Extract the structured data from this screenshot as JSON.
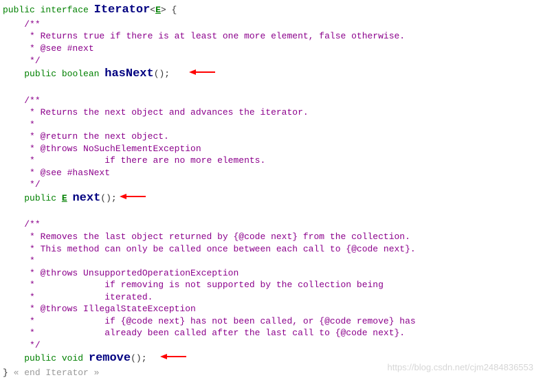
{
  "decl": {
    "kw_public": "public",
    "kw_interface": "interface",
    "cls_name": "Iterator",
    "type_param": "E",
    "open_brace": "{"
  },
  "hasNext": {
    "c_open": "/**",
    "c_l1": " * Returns true if there is at least one more element, false otherwise.",
    "c_l2": " * @see #next",
    "c_close": " */",
    "kw_public": "public",
    "ret": "boolean",
    "name": "hasNext",
    "parens": "();"
  },
  "next": {
    "c_open": "/**",
    "c_l1": " * Returns the next object and advances the iterator.",
    "c_l2": " *",
    "c_l3": " * @return the next object.",
    "c_l4": " * @throws NoSuchElementException",
    "c_l5": " *             if there are no more elements.",
    "c_l6": " * @see #hasNext",
    "c_close": " */",
    "kw_public": "public",
    "ret": "E",
    "name": "next",
    "parens": "();"
  },
  "remove": {
    "c_open": "/**",
    "c_l1": " * Removes the last object returned by {@code next} from the collection.",
    "c_l2": " * This method can only be called once between each call to {@code next}.",
    "c_l3": " *",
    "c_l4": " * @throws UnsupportedOperationException",
    "c_l5": " *             if removing is not supported by the collection being",
    "c_l6": " *             iterated.",
    "c_l7": " * @throws IllegalStateException",
    "c_l8": " *             if {@code next} has not been called, or {@code remove} has",
    "c_l9": " *             already been called after the last call to {@code next}.",
    "c_close": " */",
    "kw_public": "public",
    "ret": "void",
    "name": "remove",
    "parens": "();"
  },
  "footer": {
    "close_brace": "}",
    "end_comment": "« end Iterator »"
  },
  "watermark": "https://blog.csdn.net/cjm2484836553"
}
